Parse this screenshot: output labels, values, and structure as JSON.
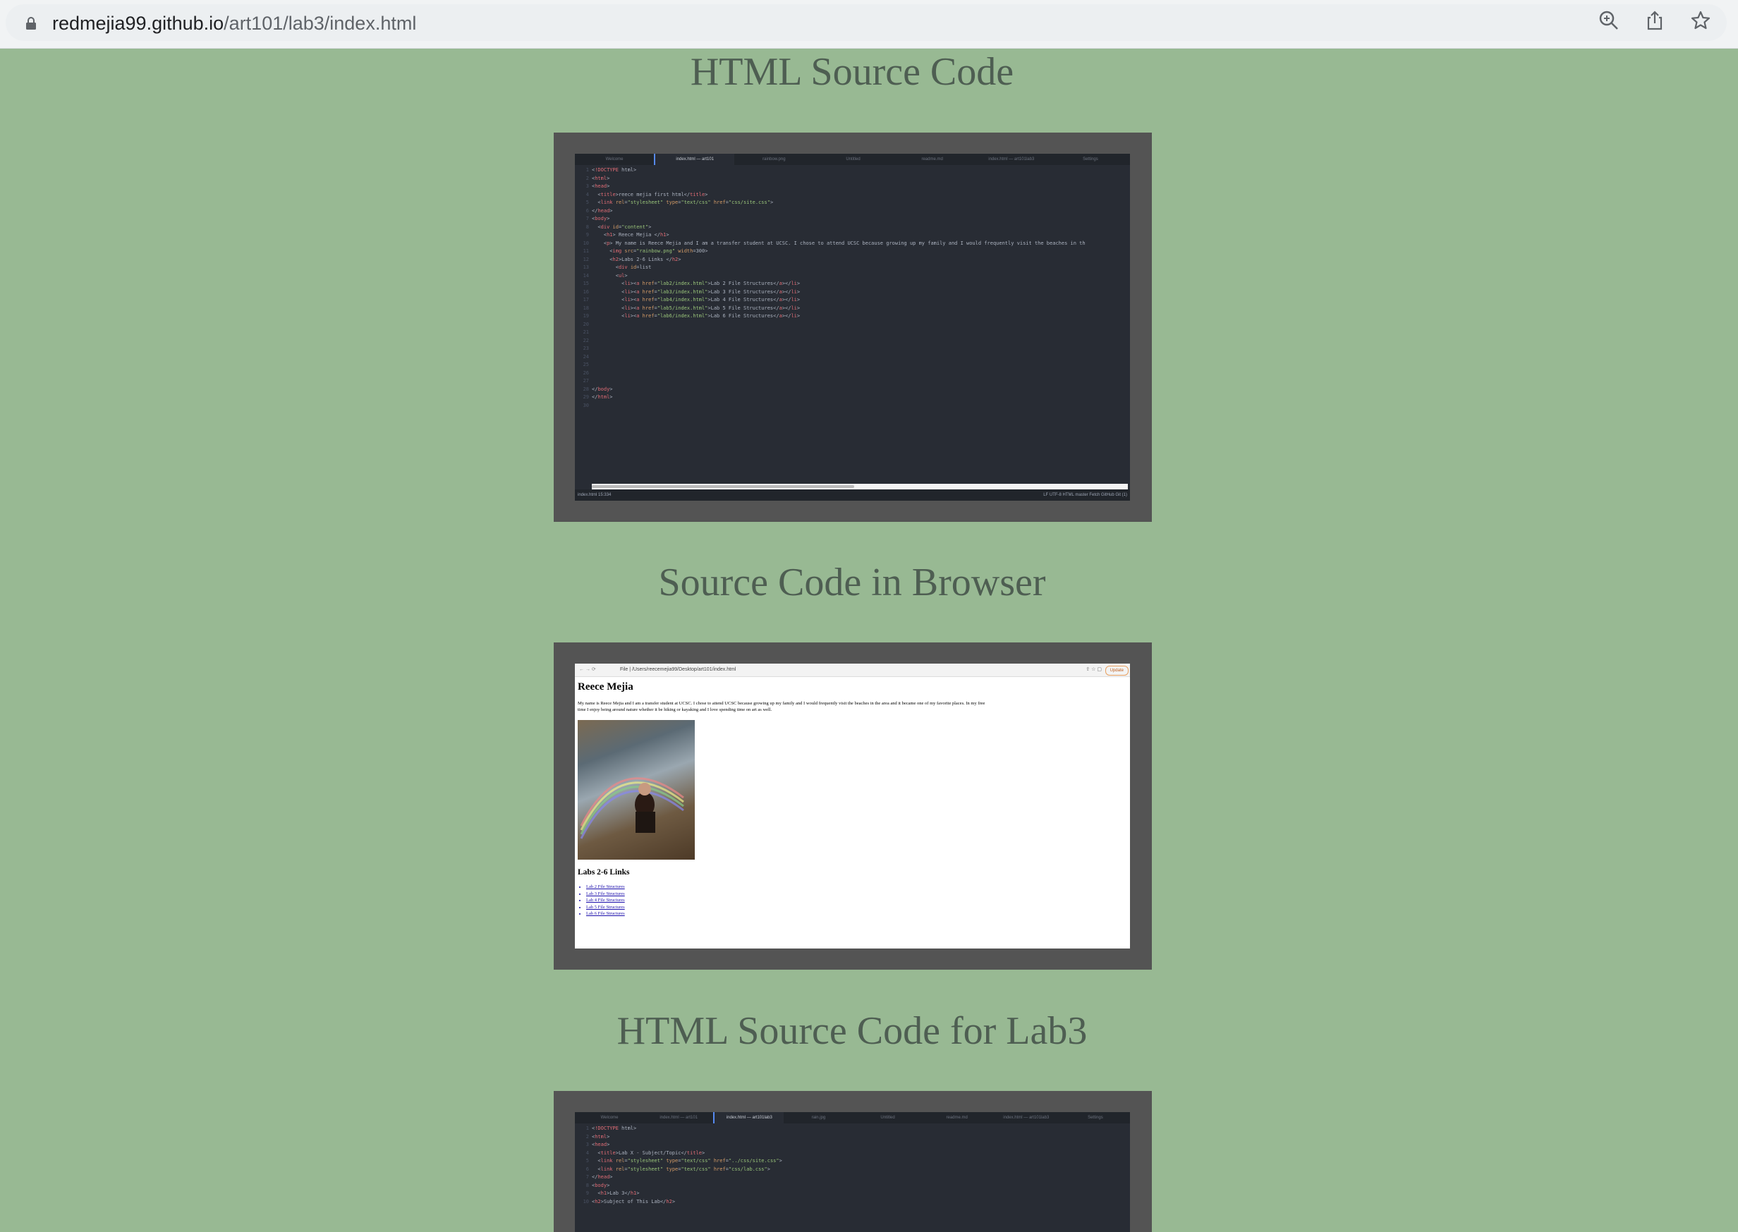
{
  "browser": {
    "url_host": "redmejia99.github.io",
    "url_path": "/art101/lab3/index.html",
    "icons": [
      "lock-icon",
      "zoom-icon",
      "share-icon",
      "bookmark-star-icon"
    ]
  },
  "page": {
    "heading1": "HTML Source Code",
    "heading2": "Source Code in Browser",
    "heading3": "HTML Source Code for Lab3"
  },
  "editor1": {
    "tabs": [
      "Welcome",
      "index.html — art101",
      "rainbow.png",
      "Untitled",
      "readme.md",
      "index.html — art101lab3",
      "Settings"
    ],
    "active_tab": 1,
    "lines": [
      "<!DOCTYPE html>",
      "<html>",
      "<head>",
      "  <title>reece mejia first html</title>",
      "  <link rel=\"stylesheet\" type=\"text/css\" href=\"css/site.css\">",
      "</head>",
      "<body>",
      "  <div id=\"content\">",
      "    <h1> Reece Mejia </h1>",
      "    <p> My name is Reece Mejia and I am a transfer student at UCSC. I chose to attend UCSC because growing up my family and I would frequently visit the beaches in th",
      "      <img src=\"rainbow.png\" width=300>",
      "      <h2>Labs 2-6 Links </h2>",
      "        <div id=list",
      "        <ul>",
      "          <li><a href=\"lab2/index.html\">Lab 2 File Structures</a></li>",
      "          <li><a href=\"lab3/index.html\">Lab 3 File Structures</a></li>",
      "          <li><a href=\"lab4/index.html\">Lab 4 File Structures</a></li>",
      "          <li><a href=\"lab5/index.html\">Lab 5 File Structures</a></li>",
      "          <li><a href=\"lab6/index.html\">Lab 6 File Structures</a></li>",
      "",
      "",
      "",
      "",
      "",
      "",
      "",
      "",
      "</body>",
      "</html>",
      ""
    ],
    "status_left": "index.html   15:334",
    "status_right": "LF   UTF-8   HTML   master   Fetch   GitHub   Git (1)"
  },
  "browser_shot": {
    "address": "File  |  /Users/reecemejia99/Desktop/art101/index.html",
    "update_label": "Update",
    "h1": "Reece Mejia",
    "paragraph_line1": "My name is Reece Mejia and I am a transfer student at UCSC. I chose to attend UCSC because growing up my family and I would frequently visit the beaches in the area and it became one of my favorite places. In my free",
    "paragraph_line2": "time I enjoy being around nature whether it be hiking or kayaking and I love spending time on art as well.",
    "h2": "Labs 2-6 Links",
    "links": [
      "Lab 2 File Structures",
      "Lab 3 File Structures",
      "Lab 4 File Structures",
      "Lab 5 File Structures",
      "Lab 6 File Structures"
    ]
  },
  "editor2": {
    "tabs": [
      "Welcome",
      "index.html — art101",
      "index.html — art101lab3",
      "rain.jpg",
      "Untitled",
      "readme.md",
      "index.html — art101lab3",
      "Settings"
    ],
    "active_tab": 2,
    "lines": [
      "<!DOCTYPE html>",
      "<html>",
      "<head>",
      "  <title>Lab X - Subject/Topic</title>",
      "  <link rel=\"stylesheet\" type=\"text/css\" href=\"../css/site.css\">",
      "  <link rel=\"stylesheet\" type=\"text/css\" href=\"css/lab.css\">",
      "</head>",
      "<body>",
      "  <h1>Lab 3</h1>",
      "<h2>Subject of This Lab</h2>"
    ]
  }
}
